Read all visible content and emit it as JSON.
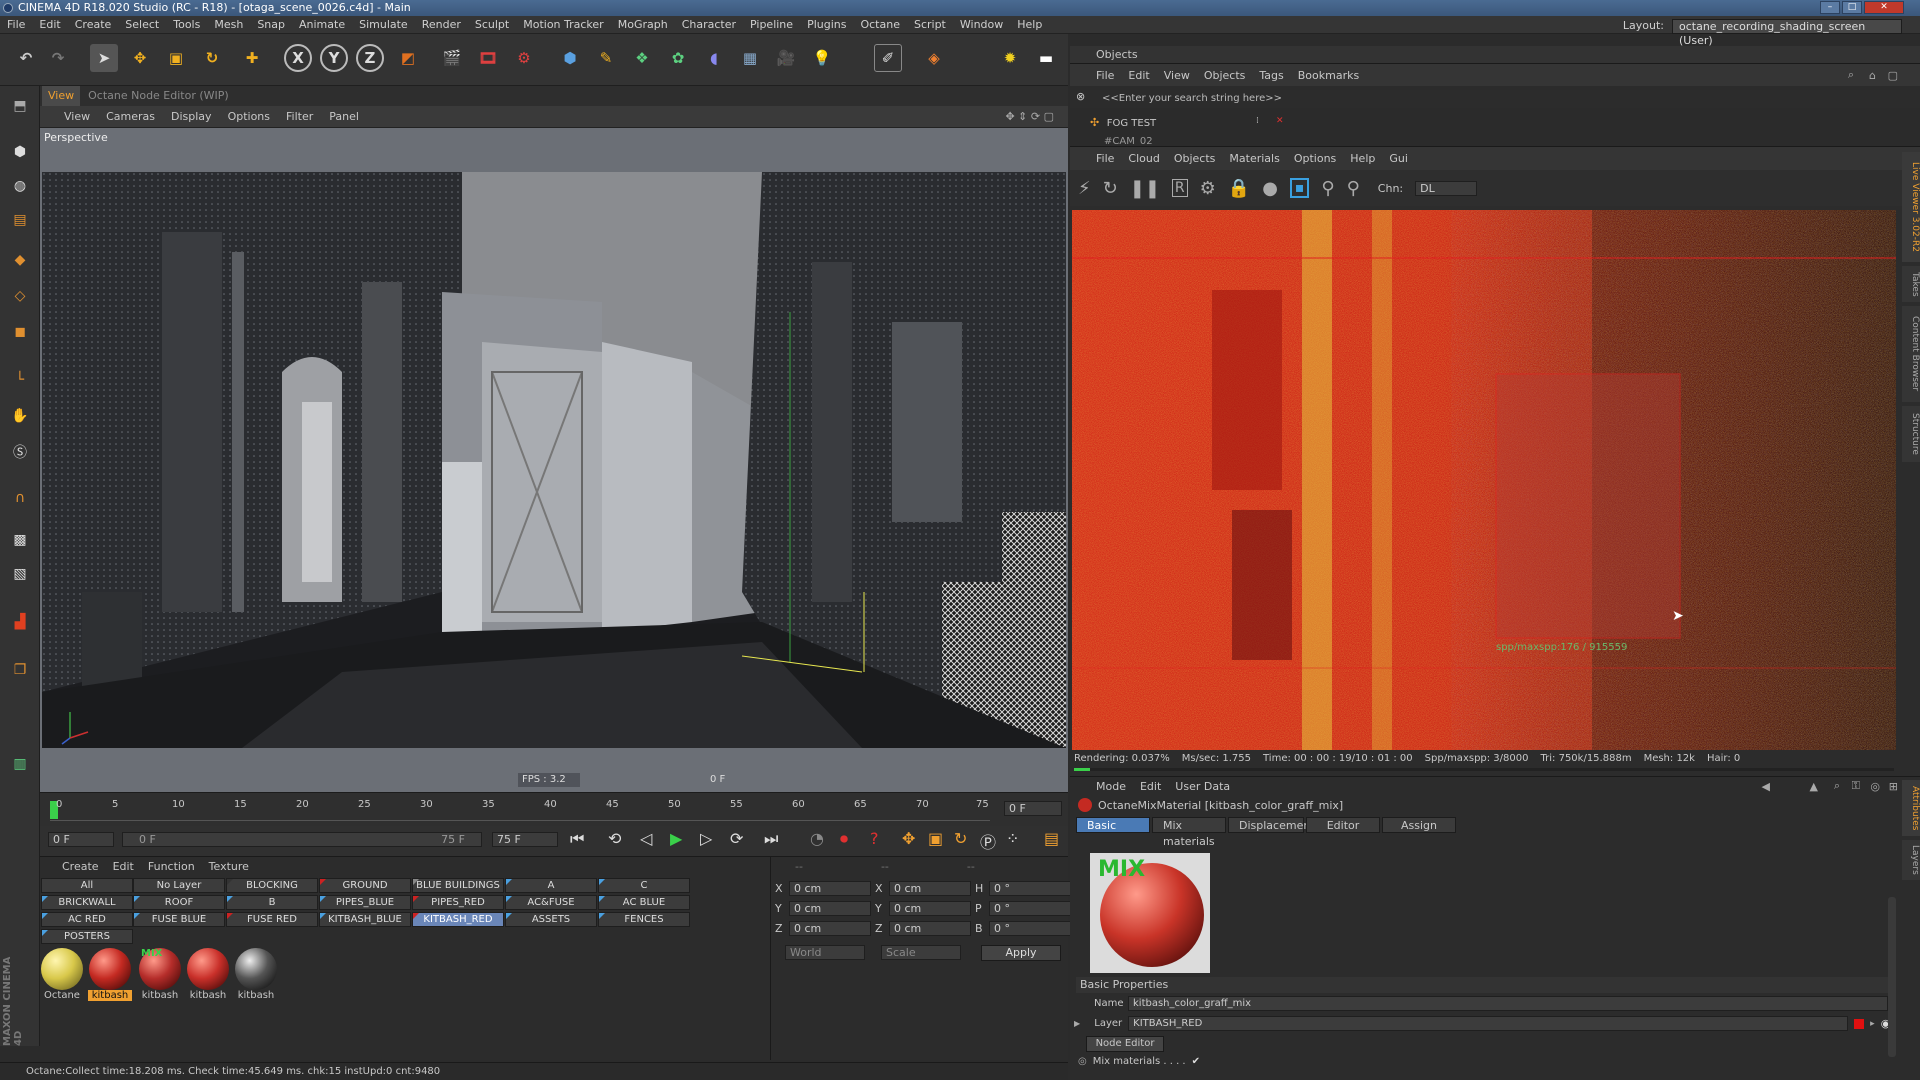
{
  "window": {
    "title": "CINEMA 4D R18.020 Studio (RC - R18) - [otaga_scene_0026.c4d] - Main"
  },
  "menu": [
    "File",
    "Edit",
    "Create",
    "Select",
    "Tools",
    "Mesh",
    "Snap",
    "Animate",
    "Simulate",
    "Render",
    "Sculpt",
    "Motion Tracker",
    "MoGraph",
    "Character",
    "Pipeline",
    "Plugins",
    "Octane",
    "Script",
    "Window",
    "Help"
  ],
  "layout": {
    "label": "Layout:",
    "value": "octane_recording_shading_screen (User)"
  },
  "viewport": {
    "tabs": [
      "View",
      "Octane Node Editor (WIP)"
    ],
    "menu": [
      "View",
      "Cameras",
      "Display",
      "Options",
      "Filter",
      "Panel"
    ],
    "label": "Perspective",
    "fps": "FPS : 3.2",
    "frame": "0 F"
  },
  "timeline": {
    "ticks": [
      "0",
      "5",
      "10",
      "15",
      "20",
      "25",
      "30",
      "35",
      "40",
      "45",
      "50",
      "55",
      "60",
      "65",
      "70",
      "75"
    ],
    "end_field": "0 F",
    "start_field": "0 F",
    "range_start": "0 F",
    "range_end": "75 F",
    "max_field": "75 F"
  },
  "materials": {
    "menu": [
      "Create",
      "Edit",
      "Function",
      "Texture"
    ],
    "layers": [
      [
        "All",
        "No Layer",
        "BLOCKING",
        "GROUND",
        "BLUE BUILDINGS",
        "A",
        "C"
      ],
      [
        "BRICKWALL",
        "ROOF",
        "B",
        "PIPES_BLUE",
        "PIPES_RED",
        "AC&FUSE",
        "AC BLUE"
      ],
      [
        "AC RED",
        "FUSE BLUE",
        "FUSE RED",
        "KITBASH_BLUE",
        "KITBASH_RED",
        "ASSETS",
        "FENCES"
      ],
      [
        "POSTERS"
      ]
    ],
    "balls": [
      {
        "label": "Octane",
        "color": "#d8c84a"
      },
      {
        "label": "kitbash",
        "color": "#c42a22"
      },
      {
        "label": "kitbash",
        "color": "#b52d2a"
      },
      {
        "label": "kitbash",
        "color": "#c9302a"
      },
      {
        "label": "kitbash",
        "color": "#555555"
      }
    ],
    "mix_badge": "MIX"
  },
  "coords": {
    "header": [
      "--",
      "--",
      "--"
    ],
    "rows": [
      {
        "a": "X",
        "v1": "0 cm",
        "b": "X",
        "v2": "0 cm",
        "c": "H",
        "v3": "0 °"
      },
      {
        "a": "Y",
        "v1": "0 cm",
        "b": "Y",
        "v2": "0 cm",
        "c": "P",
        "v3": "0 °"
      },
      {
        "a": "Z",
        "v1": "0 cm",
        "b": "Z",
        "v2": "0 cm",
        "c": "B",
        "v3": "0 °"
      }
    ],
    "world": "World",
    "scale": "Scale",
    "apply": "Apply"
  },
  "status": "Octane:Collect time:18.208 ms.  Check time:45.649 ms.  chk:15  instUpd:0  cnt:9480",
  "objects": {
    "title": "Objects",
    "menu": [
      "File",
      "Edit",
      "View",
      "Objects",
      "Tags",
      "Bookmarks"
    ],
    "search": "<<Enter your search string here>>",
    "items": [
      "FOG TEST",
      "#CAM_02"
    ]
  },
  "liveviewer": {
    "menu": [
      "File",
      "Cloud",
      "Objects",
      "Materials",
      "Options",
      "Help",
      "Gui"
    ],
    "chn_label": "Chn:",
    "chn_value": "DL",
    "spp_overlay": "spp/maxspp:176 / 915559",
    "stats": {
      "rendering": "Rendering: 0.037%",
      "mssec": "Ms/sec: 1.755",
      "time": "Time: 00 : 00 : 19/10 : 01 : 00",
      "spp": "Spp/maxspp: 3/8000",
      "tri": "Tri: 750k/15.888m",
      "mesh": "Mesh: 12k",
      "hair": "Hair: 0"
    },
    "side_tabs": [
      "Live Viewer 3.02-R2",
      "Takes",
      "Content Browser",
      "Structure"
    ]
  },
  "attributes": {
    "menu": [
      "Mode",
      "Edit",
      "User Data"
    ],
    "title": "OctaneMixMaterial [kitbash_color_graff_mix]",
    "tabs": [
      "Basic",
      "Mix materials",
      "Displacement",
      "Editor",
      "Assign"
    ],
    "preview_badge": "MIX",
    "section": "Basic Properties",
    "name_label": "Name",
    "name_value": "kitbash_color_graff_mix",
    "layer_label": "Layer",
    "layer_value": "KITBASH_RED",
    "node_editor": "Node Editor",
    "mix_materials": "Mix materials . . . .",
    "side_tabs": [
      "Attributes",
      "Layers"
    ]
  },
  "branding": {
    "maxon": "MAXON",
    "c4d": "CINEMA 4D"
  }
}
